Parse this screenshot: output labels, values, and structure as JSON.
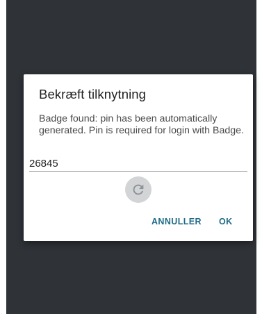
{
  "dialog": {
    "title": "Bekræft tilknytning",
    "message": "Badge found: pin has been automatically generated. Pin is required for login with Badge.",
    "pin_value": "26845",
    "refresh_icon": "refresh-icon",
    "cancel_label": "ANNULLER",
    "ok_label": "OK"
  },
  "colors": {
    "backdrop": "#2f3338",
    "dialog_bg": "#ffffff",
    "accent": "#1f6a86",
    "refresh_bg": "#d2d4d6",
    "refresh_icon": "#8d9196"
  }
}
